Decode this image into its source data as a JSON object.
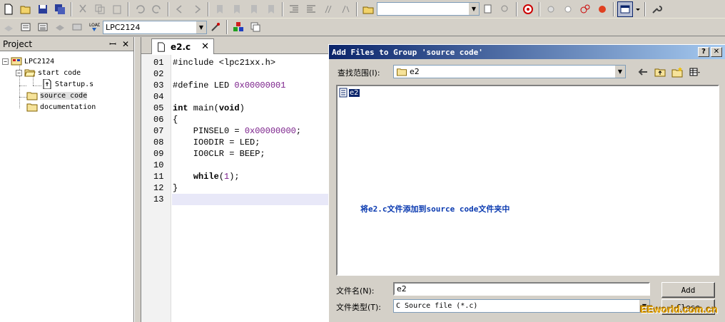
{
  "toolbar": {
    "search_combo_value": "",
    "target_combo_value": "LPC2124"
  },
  "project_panel": {
    "title": "Project",
    "pin_glyph": "ꟷ",
    "close_glyph": "✕",
    "tree": [
      {
        "label": "LPC2124",
        "icon": "target-icon",
        "expander": "−"
      },
      {
        "label": "start code",
        "icon": "folder-open-icon",
        "expander": "−"
      },
      {
        "label": "Startup.s",
        "icon": "asm-file-icon"
      },
      {
        "label": "source code",
        "icon": "folder-icon",
        "selected": true
      },
      {
        "label": "documentation",
        "icon": "folder-icon"
      }
    ]
  },
  "editor": {
    "tab_label": "e2.c",
    "tab_close": "✕",
    "line_numbers": [
      "01",
      "02",
      "03",
      "04",
      "05",
      "06",
      "07",
      "08",
      "09",
      "10",
      "11",
      "12",
      "13"
    ],
    "lines": [
      "#include <lpc21xx.h>",
      "",
      "#define LED 0x00000001",
      "",
      "int main(void)",
      "{",
      "    PINSEL0 = 0x00000000;",
      "    IO0DIR = LED;",
      "    IO0CLR = BEEP;",
      "",
      "    while(1);",
      "}",
      ""
    ]
  },
  "dialog": {
    "title": "Add Files to Group 'source code'",
    "help_btn": "?",
    "close_btn": "✕",
    "look_in_label": "查找范围(I):",
    "look_in_value": "e2",
    "file_item": "e2",
    "hint": "将e2.c文件添加到source code文件夹中",
    "filename_label": "文件名(N):",
    "filename_value": "e2",
    "filetype_label": "文件类型(T):",
    "filetype_value": "C Source file (*.c)",
    "add_button": "Add",
    "close_button": "Close"
  },
  "watermark": "EEworld.com.cn",
  "colors": {
    "titlebar_start": "#0a246a",
    "titlebar_end": "#a6caf0",
    "hint_text": "#0a3ab0",
    "selection": "#0a246a"
  }
}
